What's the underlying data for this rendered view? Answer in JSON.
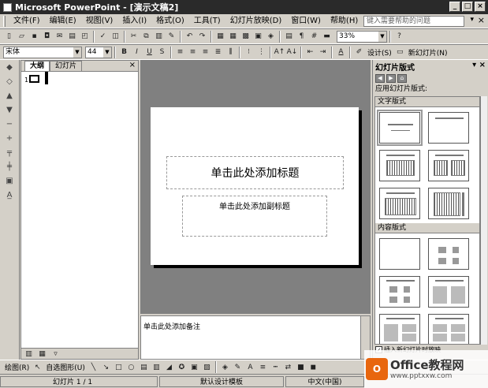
{
  "app": {
    "title": "Microsoft PowerPoint - [演示文稿2]",
    "window_buttons": [
      "_",
      "□",
      "×"
    ]
  },
  "menu": {
    "items": [
      "文件(F)",
      "编辑(E)",
      "视图(V)",
      "插入(I)",
      "格式(O)",
      "工具(T)",
      "幻灯片放映(D)",
      "窗口(W)",
      "帮助(H)"
    ],
    "help_placeholder": "键入需要帮助的问题",
    "help_arrow": "▾",
    "close": "×"
  },
  "toolbar_standard": {
    "zoom": "33%",
    "help": "?"
  },
  "toolbar_format": {
    "font": "宋体",
    "size": "44",
    "bold": "B",
    "italic": "I",
    "underline": "U",
    "shadow": "S",
    "grow": "A↑",
    "shrink": "A↓",
    "font_color": "A",
    "design_label": "设计(S)",
    "new_slide_label": "新幻灯片(N)"
  },
  "outline_pane": {
    "tabs": [
      "大纲",
      "幻灯片"
    ],
    "close": "×",
    "slide_number": "1"
  },
  "slide": {
    "title_placeholder": "单击此处添加标题",
    "subtitle_placeholder": "单击此处添加副标题"
  },
  "notes": {
    "placeholder": "单击此处添加备注"
  },
  "task_pane": {
    "title": "幻灯片版式",
    "apply_label": "应用幻灯片版式:",
    "categories": [
      "文字版式",
      "内容版式"
    ],
    "checkbox_label": "插入新幻灯片时放映",
    "checkbox_checked": true
  },
  "draw_toolbar": {
    "draw_label": "绘图(R)",
    "autoshape_label": "自选图形(U)"
  },
  "statusbar": {
    "slide_info": "幻灯片 1 / 1",
    "template": "默认设计模板",
    "language": "中文(中国)"
  },
  "watermark": {
    "logo": "O",
    "title": "Office教程网",
    "url": "www.pptxxw.com"
  }
}
